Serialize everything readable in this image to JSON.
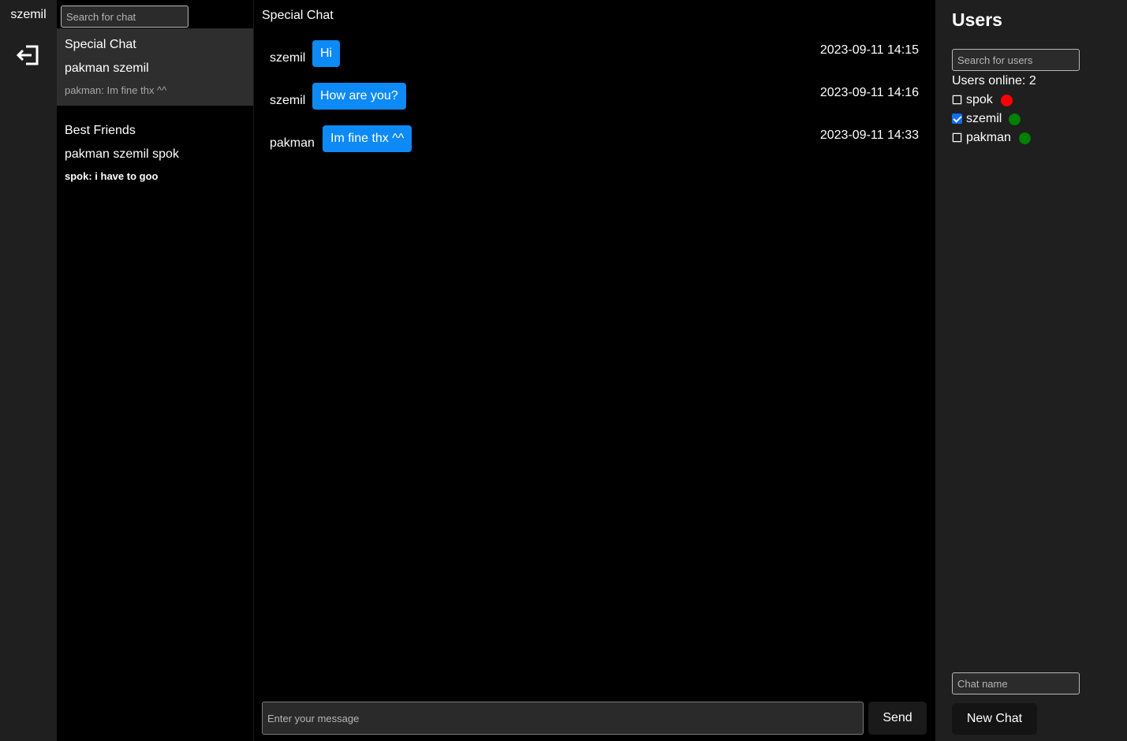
{
  "rail": {
    "username": "szemil",
    "logout_icon": "logout-icon"
  },
  "chatlist": {
    "search_placeholder": "Search for chat",
    "chats": [
      {
        "name": "Special Chat",
        "members": "pakman szemil",
        "last_message": "pakman: Im fine thx ^^",
        "active": true,
        "unread": false
      },
      {
        "name": "Best Friends",
        "members": "pakman szemil spok",
        "last_message": "spok: i have to goo",
        "active": false,
        "unread": true
      }
    ]
  },
  "main": {
    "title": "Special Chat",
    "messages": [
      {
        "sender": "szemil",
        "text": "Hi",
        "time": "2023-09-11 14:15"
      },
      {
        "sender": "szemil",
        "text": "How are you?",
        "time": "2023-09-11 14:16"
      },
      {
        "sender": "pakman",
        "text": "Im fine thx ^^",
        "time": "2023-09-11 14:33"
      }
    ],
    "input_placeholder": "Enter your message",
    "send_label": "Send"
  },
  "users_panel": {
    "heading": "Users",
    "search_placeholder": "Search for users",
    "online_label": "Users online: 2",
    "users": [
      {
        "name": "spok",
        "checked": false,
        "status": "offline",
        "status_color": "#ff0000"
      },
      {
        "name": "szemil",
        "checked": true,
        "status": "online",
        "status_color": "#008000"
      },
      {
        "name": "pakman",
        "checked": false,
        "status": "online",
        "status_color": "#008000"
      }
    ],
    "chat_name_placeholder": "Chat name",
    "new_chat_label": "New Chat"
  },
  "colors": {
    "bubble": "#0d8af5",
    "rail_bg": "#1f1f1f",
    "active_chat_bg": "#2e2e2e"
  }
}
